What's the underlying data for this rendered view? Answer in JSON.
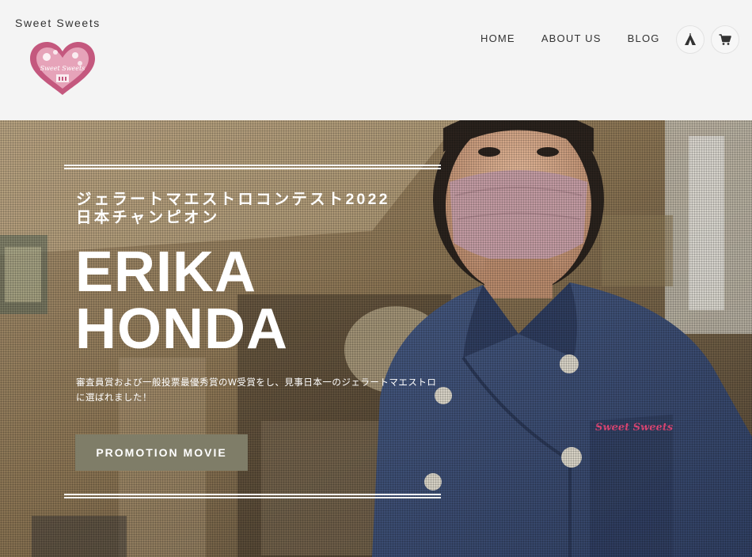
{
  "header": {
    "brand": "Sweet Sweets",
    "logo_text": "Sweet Sweets",
    "nav": [
      {
        "label": "HOME"
      },
      {
        "label": "ABOUT US"
      },
      {
        "label": "BLOG"
      }
    ],
    "icons": [
      "tent-icon",
      "cart-icon"
    ]
  },
  "hero": {
    "subtitle_line1": "ジェラートマエストロコンテスト2022",
    "subtitle_line2": "日本チャンピオン",
    "name_line1": "ERIKA",
    "name_line2": "HONDA",
    "description": "審査員賞および一般投票最優秀賞のW受賞をし、見事日本一のジェラートマエストロに選ばれました！",
    "button_label": "PROMOTION MOVIE",
    "jacket_embroidery": "Sweet Sweets"
  },
  "colors": {
    "header_bg": "#f4f4f4",
    "logo_pink": "#c4587e",
    "button_bg": "#7f7d68",
    "jacket": "#3c4f79"
  }
}
